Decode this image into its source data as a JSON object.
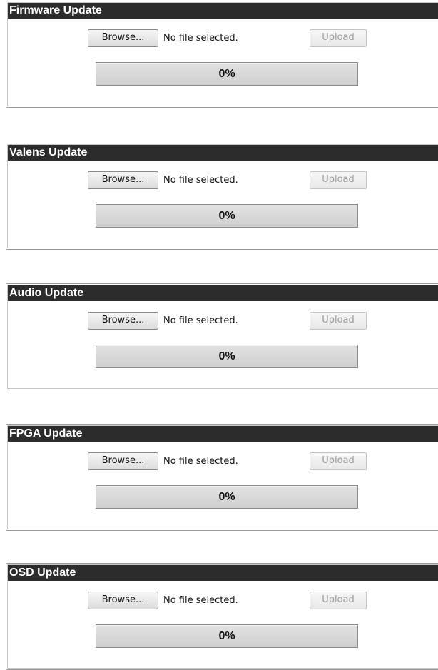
{
  "panels": [
    {
      "title": "Firmware Update",
      "browse_label": "Browse...",
      "file_status": "No file selected.",
      "upload_label": "Upload",
      "upload_enabled": false,
      "progress_label": "0%",
      "progress_fraction": 0
    },
    {
      "title": "Valens Update",
      "browse_label": "Browse...",
      "file_status": "No file selected.",
      "upload_label": "Upload",
      "upload_enabled": false,
      "progress_label": "0%",
      "progress_fraction": 0
    },
    {
      "title": "Audio Update",
      "browse_label": "Browse...",
      "file_status": "No file selected.",
      "upload_label": "Upload",
      "upload_enabled": false,
      "progress_label": "0%",
      "progress_fraction": 0
    },
    {
      "title": "FPGA Update",
      "browse_label": "Browse...",
      "file_status": "No file selected.",
      "upload_label": "Upload",
      "upload_enabled": false,
      "progress_label": "0%",
      "progress_fraction": 0
    },
    {
      "title": "OSD Update",
      "browse_label": "Browse...",
      "file_status": "No file selected.",
      "upload_label": "Upload",
      "upload_enabled": false,
      "progress_label": "0%",
      "progress_fraction": 0
    }
  ],
  "colors": {
    "header_background": "#2c2c2c",
    "header_text": "#ffffff",
    "progress_bar": "#d6d6d6",
    "disabled_text": "#9b9b9b"
  }
}
